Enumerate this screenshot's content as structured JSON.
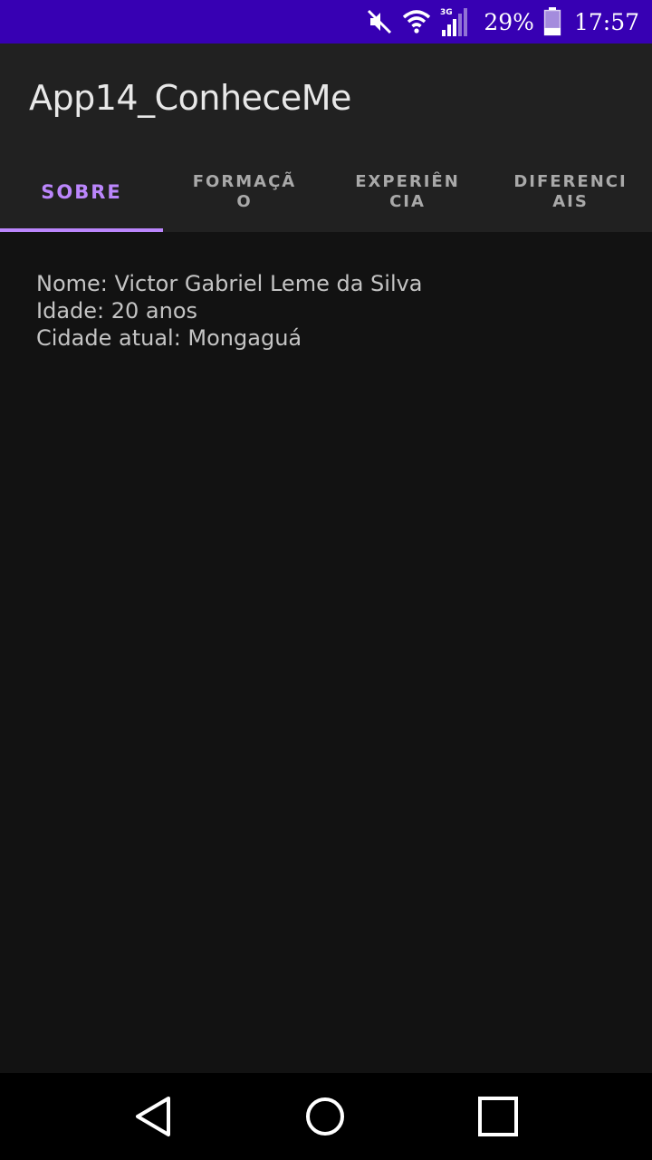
{
  "status_bar": {
    "battery_percent": "29%",
    "time": "17:57",
    "network_type": "3G",
    "icons": [
      "mute-icon",
      "wifi-icon",
      "signal-icon",
      "battery-icon"
    ],
    "battery_level": 0.29,
    "background_color": "#3700b3"
  },
  "app_bar": {
    "title": "App14_ConheceMe"
  },
  "tabs": [
    {
      "label": "SOBRE",
      "active": true
    },
    {
      "label": "FORMAÇÃO",
      "active": false
    },
    {
      "label": "EXPERIÊNCIA",
      "active": false
    },
    {
      "label": "DIFERENCIAIS",
      "active": false
    }
  ],
  "colors": {
    "accent": "#bb86fc",
    "background": "#121212",
    "surface": "#212121",
    "inactive_tab_text": "#a9a9a9",
    "body_text": "#c4c4c4"
  },
  "content": {
    "lines": [
      "Nome: Victor Gabriel Leme da Silva",
      "Idade: 20 anos",
      "Cidade atual: Mongaguá"
    ]
  },
  "nav_bar": {
    "icons": [
      "back-icon",
      "home-icon",
      "recents-icon"
    ]
  }
}
